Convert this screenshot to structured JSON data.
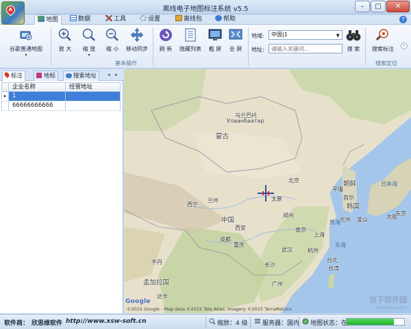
{
  "window": {
    "title": "离线电子地图标注系统 v5.5"
  },
  "menu": {
    "tabs": [
      {
        "label": "地图",
        "icon": "map-tab-icon"
      },
      {
        "label": "数据",
        "icon": "table-icon"
      },
      {
        "label": "工具",
        "icon": "tools-icon"
      },
      {
        "label": "设置",
        "icon": "gear-icon"
      },
      {
        "label": "离线包",
        "icon": "package-icon"
      },
      {
        "label": "帮助",
        "icon": "help-icon"
      }
    ],
    "active_tab": "地图"
  },
  "ribbon": {
    "buttons": [
      {
        "label": "谷歌普通地图",
        "icon": "map-source-icon"
      },
      {
        "label": "放 大",
        "icon": "zoom-in-icon"
      },
      {
        "label": "缩 放",
        "icon": "zoom-icon"
      },
      {
        "label": "缩 小",
        "icon": "zoom-out-icon"
      },
      {
        "label": "移动同步",
        "icon": "move-sync-icon"
      },
      {
        "label": "刷 新",
        "icon": "refresh-icon"
      },
      {
        "label": "隐藏列表",
        "icon": "hide-list-icon"
      },
      {
        "label": "截 屏",
        "icon": "screenshot-icon"
      },
      {
        "label": "全 屏",
        "icon": "fullscreen-icon"
      },
      {
        "label": "搜 索",
        "icon": "binoculars-icon"
      },
      {
        "label": "搜索标注",
        "icon": "search-marker-icon"
      }
    ],
    "group_basic_label": "基本操作",
    "group_search_label": "搜索定位",
    "region_label": "地域:",
    "region_value": "中国|1",
    "address_label": "地址:",
    "address_placeholder": "请输入关键词..."
  },
  "panel": {
    "tabs": [
      "标注",
      "地标",
      "搜索地址"
    ],
    "nav_prev": "◂",
    "nav_next": "▸",
    "columns": [
      "企业名称",
      "经营地址"
    ],
    "rows": [
      {
        "name": "1",
        "address": "",
        "selected": true
      },
      {
        "name": "66666666666",
        "address": "",
        "selected": false
      }
    ],
    "row_marker": "▸"
  },
  "map": {
    "labels": [
      {
        "text": "乌兰巴托",
        "kind": "city"
      },
      {
        "text": "Улаанбаатар",
        "kind": "city"
      },
      {
        "text": "蒙古",
        "kind": "country"
      },
      {
        "text": "北京",
        "kind": "city"
      },
      {
        "text": "朝鲜",
        "kind": "country"
      },
      {
        "text": "平壤",
        "kind": "city"
      },
      {
        "text": "首尔",
        "kind": "city"
      },
      {
        "text": "韩国",
        "kind": "country"
      },
      {
        "text": "日本海",
        "kind": "sea"
      },
      {
        "text": "黄海",
        "kind": "sea"
      },
      {
        "text": "东海",
        "kind": "sea"
      },
      {
        "text": "光州",
        "kind": "city"
      },
      {
        "text": "釜山",
        "kind": "city"
      },
      {
        "text": "大阪",
        "kind": "city"
      },
      {
        "text": "中国",
        "kind": "country"
      },
      {
        "text": "南京",
        "kind": "city"
      },
      {
        "text": "上海",
        "kind": "city"
      },
      {
        "text": "成都",
        "kind": "city"
      },
      {
        "text": "重庆",
        "kind": "city"
      },
      {
        "text": "杭州",
        "kind": "city"
      },
      {
        "text": "不丹",
        "kind": "country"
      },
      {
        "text": "孟加拉国",
        "kind": "country"
      },
      {
        "text": "达卡",
        "kind": "city"
      },
      {
        "text": "广州",
        "kind": "city"
      },
      {
        "text": "台湾",
        "kind": "region"
      },
      {
        "text": "台北",
        "kind": "city"
      },
      {
        "text": "东京",
        "kind": "city"
      },
      {
        "text": "西宁",
        "kind": "city"
      },
      {
        "text": "兰州",
        "kind": "city"
      },
      {
        "text": "西安",
        "kind": "city"
      },
      {
        "text": "太原",
        "kind": "city"
      },
      {
        "text": "郑州",
        "kind": "city"
      },
      {
        "text": "武汉",
        "kind": "city"
      },
      {
        "text": "长沙",
        "kind": "city"
      }
    ],
    "google_mark": "Google",
    "copyright": "©2015 Google - Map data ©2015 Tele Atlas, Imagery ©2015 TerraMetrics"
  },
  "watermark": {
    "main": "当下软件园",
    "sub": "downxia.com"
  },
  "status": {
    "software_label": "软件商：",
    "software_name": "欣思维软件",
    "url": "http://www.xsw-soft.cn",
    "zoom_text": "缩放：4 级",
    "server_text": "服务器：国内",
    "map_state_text": "地图状态：在线",
    "progress": 0.82
  },
  "colors": {
    "accent": "#3f7ed9",
    "land": "#e7e1cc",
    "sea": "#a4c6ea",
    "progress": "#28b52e"
  }
}
